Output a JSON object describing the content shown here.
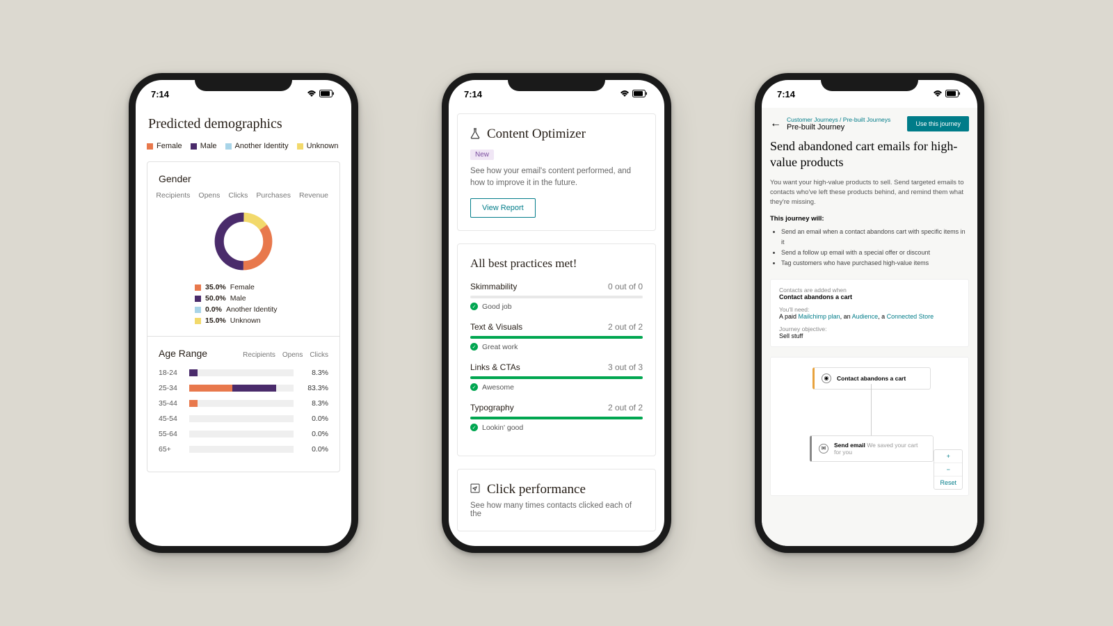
{
  "statusBar": {
    "time": "7:14"
  },
  "colors": {
    "female": "#e8784c",
    "male": "#4a2b6b",
    "another": "#a8d4e8",
    "unknown": "#f2d96b",
    "green": "#00a650",
    "teal": "#007c89"
  },
  "phone1": {
    "title": "Predicted demographics",
    "legend": [
      "Female",
      "Male",
      "Another Identity",
      "Unknown"
    ],
    "genderSection": {
      "title": "Gender",
      "tabs": [
        "Recipients",
        "Opens",
        "Clicks",
        "Purchases",
        "Revenue"
      ],
      "breakdown": [
        {
          "label": "Female",
          "pct": "35.0%"
        },
        {
          "label": "Male",
          "pct": "50.0%"
        },
        {
          "label": "Another Identity",
          "pct": "0.0%"
        },
        {
          "label": "Unknown",
          "pct": "15.0%"
        }
      ]
    },
    "ageSection": {
      "title": "Age Range",
      "tabs": [
        "Recipients",
        "Opens",
        "Clicks"
      ],
      "rows": [
        {
          "label": "18-24",
          "pct": "8.3%"
        },
        {
          "label": "25-34",
          "pct": "83.3%"
        },
        {
          "label": "35-44",
          "pct": "8.3%"
        },
        {
          "label": "45-54",
          "pct": "0.0%"
        },
        {
          "label": "55-64",
          "pct": "0.0%"
        },
        {
          "label": "65+",
          "pct": "0.0%"
        }
      ]
    }
  },
  "phone2": {
    "optimizer": {
      "title": "Content Optimizer",
      "badge": "New",
      "desc": "See how your email's content performed, and how to improve it in the future.",
      "button": "View Report"
    },
    "practices": {
      "title": "All best practices met!",
      "items": [
        {
          "name": "Skimmability",
          "score": "0 out of 0",
          "msg": "Good job",
          "fill": 0
        },
        {
          "name": "Text & Visuals",
          "score": "2 out of 2",
          "msg": "Great work",
          "fill": 100
        },
        {
          "name": "Links & CTAs",
          "score": "3 out of 3",
          "msg": "Awesome",
          "fill": 100
        },
        {
          "name": "Typography",
          "score": "2 out of 2",
          "msg": "Lookin' good",
          "fill": 100
        }
      ]
    },
    "clickPerf": {
      "title": "Click performance",
      "desc": "See how many times contacts clicked each of the"
    }
  },
  "phone3": {
    "breadcrumb": "Customer Journeys / Pre-built Journeys",
    "subtitle": "Pre-built Journey",
    "cta": "Use this journey",
    "title": "Send abandoned cart emails for high-value products",
    "desc": "You want your high-value products to sell. Send targeted emails to contacts who've left these products behind, and remind them what they're missing.",
    "willLabel": "This journey will:",
    "bullets": [
      "Send an email when a contact abandons cart with specific items in it",
      "Send a follow up email with a special offer or discount",
      "Tag customers who have purchased high-value items"
    ],
    "info": {
      "addedLabel": "Contacts are added when",
      "addedValue": "Contact abandons a cart",
      "needLabel": "You'll need:",
      "needPrefix": "A paid ",
      "link1": "Mailchimp plan",
      "sep1": ", an ",
      "link2": "Audience",
      "sep2": ", a ",
      "link3": "Connected Store",
      "objLabel": "Journey objective:",
      "objValue": "Sell stuff"
    },
    "flow": {
      "startNode": "Contact abandons a cart",
      "emailLabel": "Send email",
      "emailSubject": "We saved your cart for you",
      "zoomIn": "+",
      "zoomOut": "−",
      "reset": "Reset"
    }
  },
  "chart_data": [
    {
      "type": "pie",
      "title": "Gender",
      "series": [
        {
          "name": "Female",
          "value": 35.0
        },
        {
          "name": "Male",
          "value": 50.0
        },
        {
          "name": "Another Identity",
          "value": 0.0
        },
        {
          "name": "Unknown",
          "value": 15.0
        }
      ]
    },
    {
      "type": "bar",
      "title": "Age Range",
      "categories": [
        "18-24",
        "25-34",
        "35-44",
        "45-54",
        "55-64",
        "65+"
      ],
      "values": [
        8.3,
        83.3,
        8.3,
        0.0,
        0.0,
        0.0
      ],
      "xlabel": "",
      "ylabel": "Percent",
      "ylim": [
        0,
        100
      ]
    }
  ]
}
